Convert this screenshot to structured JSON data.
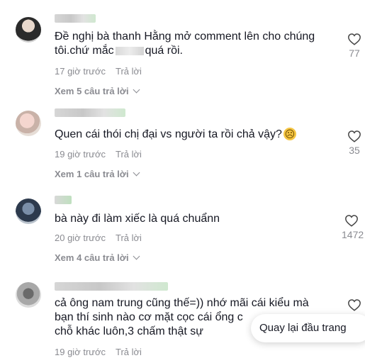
{
  "comments": [
    {
      "text_before": "Đề nghị bà thanh Hằng mở comment lên cho chúng",
      "text_line2_a": "tôi.chứ mắc",
      "text_line2_b": "quá rồi.",
      "time": "17 giờ trước",
      "reply_label": "Trả lời",
      "view_replies": "Xem 5 câu trả lời",
      "likes": "77"
    },
    {
      "text": "Quen cái thói chị đại vs người ta rồi chả vậy?",
      "emoji": "☹",
      "time": "19 giờ trước",
      "reply_label": "Trả lời",
      "view_replies": "Xem 1 câu trả lời",
      "likes": "35"
    },
    {
      "text": "bà này đi làm xiếc là quá chuẩnn",
      "time": "20 giờ trước",
      "reply_label": "Trả lời",
      "view_replies": "Xem 4 câu trả lời",
      "likes": "1472"
    },
    {
      "line1": "cả ông nam trung cũng thế=)) nhớ mãi cái kiểu mà",
      "line2": "bạn thí sinh nào cơ mặt cọc cái ổng c",
      "line3": "chỗ khác luôn,3 chấm thật sự",
      "time": "19 giờ trước",
      "reply_label": "Trả lời"
    }
  ],
  "back_to_top_label": "Quay lại đầu trang",
  "colors": {
    "text": "#161823",
    "meta": "#8a8b91",
    "background": "#ffffff"
  },
  "icons": [
    "heart-icon",
    "chevron-down-icon"
  ]
}
